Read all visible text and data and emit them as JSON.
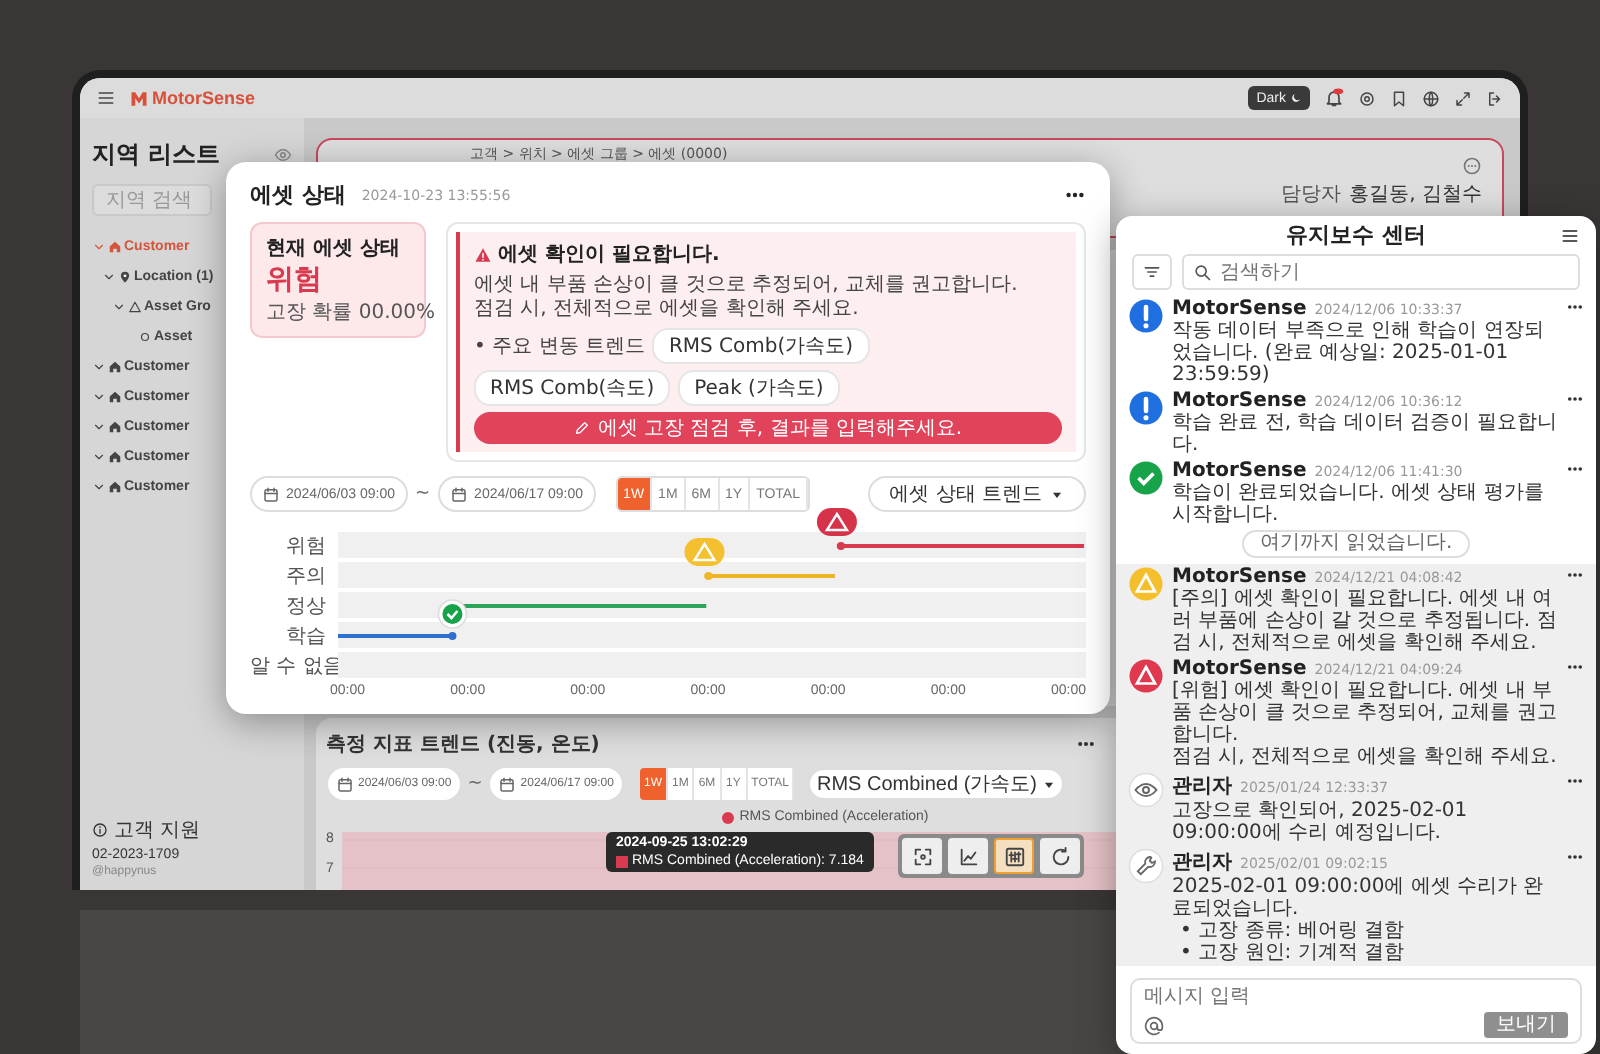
{
  "topbar": {
    "logo": "MotorSense",
    "theme_button": "Dark"
  },
  "sidebar": {
    "title": "지역 리스트",
    "search_placeholder": "지역 검색",
    "tree": [
      {
        "kind": "customer",
        "label": "Customer",
        "selected": true,
        "children": [
          {
            "kind": "location",
            "label": "Location (1)",
            "selected": false,
            "children": [
              {
                "kind": "group",
                "label": "Asset Gro",
                "selected": false,
                "children": [
                  {
                    "kind": "asset",
                    "label": "Asset",
                    "selected": false
                  }
                ]
              }
            ]
          }
        ]
      },
      {
        "kind": "customer",
        "label": "Customer",
        "selected": false
      },
      {
        "kind": "customer",
        "label": "Customer",
        "selected": false
      },
      {
        "kind": "customer",
        "label": "Customer",
        "selected": false
      },
      {
        "kind": "customer",
        "label": "Customer",
        "selected": false
      },
      {
        "kind": "customer",
        "label": "Customer",
        "selected": false
      }
    ],
    "support": {
      "label": "고객 지원",
      "phone": "02-2023-1709",
      "handle": "@happynus"
    }
  },
  "asset_card": {
    "breadcrumb": "고객 > 위치 > 에셋 그룹 > 에셋 (0000)",
    "manager_label": "담당자",
    "managers": "홍길동, 김철수"
  },
  "trend_card": {
    "title": "측정 지표 트렌드 (진동, 온도)",
    "date_from": "2024/06/03 09:00",
    "date_separator": "~",
    "date_to": "2024/06/17 09:00",
    "ranges": [
      {
        "label": "1W",
        "selected": true
      },
      {
        "label": "1M",
        "selected": false
      },
      {
        "label": "6M",
        "selected": false
      },
      {
        "label": "1Y",
        "selected": false
      },
      {
        "label": "TOTAL",
        "selected": false
      }
    ],
    "metric_dropdown": "RMS Combined (가속도)",
    "legend": "RMS Combined (Acceleration)",
    "y_ticks": [
      "8",
      "7"
    ],
    "tooltip": {
      "time": "2024-09-25 13:02:29",
      "value": "RMS Combined (Acceleration): 7.184"
    },
    "tools": [
      {
        "kind": "focus",
        "selected": false
      },
      {
        "kind": "line",
        "selected": false
      },
      {
        "kind": "sliders",
        "selected": true
      },
      {
        "kind": "reset",
        "selected": false
      }
    ]
  },
  "status_popup": {
    "title": "에셋 상태",
    "timestamp": "2024-10-23 13:55:56",
    "current": {
      "label": "현재 에셋 상태",
      "state": "위험",
      "probability": "고장 확률 00.00%"
    },
    "alert": {
      "title": "에셋 확인이 필요합니다.",
      "text": "에셋 내 부품 손상이 클 것으로 추정되어, 교체를 권고합니다.\n점검 시, 전체적으로 에셋을 확인해 주세요.",
      "trend_label": "• 주요 변동 트렌드",
      "trends": [
        "RMS Comb(가속도)",
        "RMS Comb(속도)",
        "Peak (가속도)"
      ],
      "action": "에셋 고장 점검 후, 결과를 입력해주세요."
    },
    "date_from": "2024/06/03 09:00",
    "date_separator": "~",
    "date_to": "2024/06/17 09:00",
    "ranges": [
      {
        "label": "1W",
        "selected": true
      },
      {
        "label": "1M",
        "selected": false
      },
      {
        "label": "6M",
        "selected": false
      },
      {
        "label": "1Y",
        "selected": false
      },
      {
        "label": "TOTAL",
        "selected": false
      }
    ],
    "view_dropdown": "에셋 상태 트렌드",
    "timeline": {
      "rows": [
        {
          "label": "위험",
          "color": "#d93a4f"
        },
        {
          "label": "주의",
          "color": "#f0b429"
        },
        {
          "label": "정상",
          "color": "#2ea35a"
        },
        {
          "label": "학습",
          "color": "#2f6fd0"
        },
        {
          "label": "알 수 없음"
        }
      ],
      "x_labels": [
        "00:00",
        "00:00",
        "00:00",
        "00:00",
        "00:00",
        "00:00",
        "00:00"
      ]
    }
  },
  "maintenance_panel": {
    "title": "유지보수 센터",
    "search_placeholder": "검색하기",
    "read_marker": "여기까지 읽었습니다.",
    "messages": [
      {
        "kind": "info",
        "sender": "MotorSense",
        "time": "2024/12/06 10:33:37",
        "text": "작동 데이터 부족으로 인해 학습이 연장되었습니다. (완료 예상일: 2025-01-01 23:59:59)",
        "unread": false
      },
      {
        "kind": "info",
        "sender": "MotorSense",
        "time": "2024/12/06 10:36:12",
        "text": "학습 완료 전, 학습 데이터 검증이 필요합니다.",
        "unread": false
      },
      {
        "kind": "ok",
        "sender": "MotorSense",
        "time": "2024/12/06 11:41:30",
        "text": "학습이 완료되었습니다. 에셋 상태 평가를 시작합니다.",
        "unread": false
      },
      {
        "kind": "warn",
        "sender": "MotorSense",
        "time": "2024/12/21 04:08:42",
        "text": "[주의] 에셋 확인이 필요합니다. 에셋 내 여러 부품에 손상이 갈 것으로 추정됩니다. 점검 시, 전체적으로 에셋을 확인해 주세요.",
        "unread": true
      },
      {
        "kind": "danger",
        "sender": "MotorSense",
        "time": "2024/12/21 04:09:24",
        "text": "[위험] 에셋 확인이 필요합니다. 에셋 내 부품 손상이 클 것으로 추정되어, 교체를 권고합니다.\n점검 시, 전체적으로 에셋을 확인해 주세요.",
        "unread": true
      },
      {
        "kind": "eye",
        "sender": "관리자",
        "time": "2025/01/24 12:33:37",
        "text": "고장으로 확인되어, 2025-02-01 09:00:00에 수리 예정입니다.",
        "unread": true
      },
      {
        "kind": "wrench",
        "sender": "관리자",
        "time": "2025/02/01 09:02:15",
        "text": "2025-02-01 09:00:00에 에셋 수리가 완료되었습니다.",
        "bullets": [
          "• 고장 종류: 베어링 결함",
          "• 고장 원인: 기계적 결함"
        ],
        "unread": true
      }
    ],
    "message_placeholder": "메시지 입력",
    "send_button": {
      "label": "보내기",
      "disabled": true
    }
  }
}
